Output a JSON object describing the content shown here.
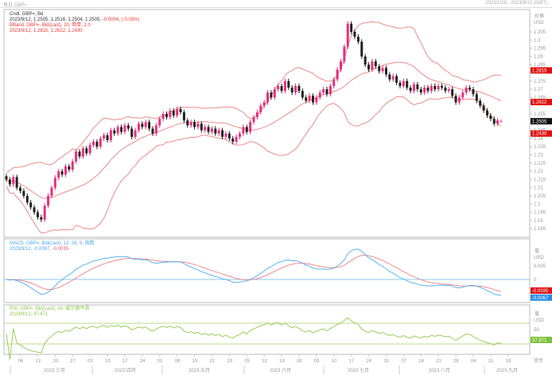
{
  "header": {
    "title": "每日 GBP=",
    "range": "2023/2/28 - 2023/9/12 (GMT)"
  },
  "legend": {
    "candle_name": "Cndl, GBP=, Bd",
    "candle_values": "2023/9/12, 1.2505, 1.2516, 1.2504, 1.2505,",
    "candle_change": "-0.0004, (-0.03%)",
    "bband_name": "BBand, GBP=, Bid(Last), 20, 简单, 2.0",
    "bband_values": "2023/9/12, 1.2815, 1.2622, 1.2430",
    "macd_name": "MACD, GBP=, Bid(Last), 12, 26, 9, 指数",
    "macd_values_a": "2023/9/12, -0.0067,",
    "macd_values_b": "-0.0035",
    "rsi_name": "RSI, GBP=, Bid(Last), 14, 威尔德平滑",
    "rsi_values": "2023/9/12, 37.871"
  },
  "colors": {
    "up": "#e8307a",
    "down": "#222222",
    "band": "#ee8a8a",
    "macd": "#5ab4f0",
    "signal": "#f08a8a",
    "rsi": "#9acd5a",
    "rsi_level": "#b8dc8e",
    "zero": "#8ccaf0",
    "badge_red": "#e01010",
    "badge_black": "#111111",
    "badge_blue": "#2a8ee8",
    "badge_green": "#7cc23a"
  },
  "chart_data": [
    {
      "type": "candlestick",
      "series_label": "GBP=",
      "ylim": [
        1.183,
        1.312
      ],
      "y_unit_label": "价格",
      "y_currency": "USD",
      "yticks": [
        "1.305",
        "1.3",
        "1.295",
        "1.29",
        "1.285",
        "1.275",
        "1.27",
        "1.265",
        "1.255",
        "1.25",
        "1.245",
        "1.24",
        "1.235",
        "1.23",
        "1.225",
        "1.22",
        "1.215",
        "1.21",
        "1.205",
        "1.2",
        "1.195",
        "1.19",
        "1.185"
      ],
      "last_candle": {
        "date": "2023/9/12",
        "open": 1.2505,
        "high": 1.2516,
        "low": 1.2504,
        "close": 1.2505
      },
      "close": [
        1.215,
        1.212,
        1.2165,
        1.21,
        1.208,
        1.205,
        1.201,
        1.198,
        1.195,
        1.192,
        1.1905,
        1.199,
        1.205,
        1.21,
        1.216,
        1.22,
        1.218,
        1.223,
        1.221,
        1.226,
        1.232,
        1.229,
        1.234,
        1.231,
        1.236,
        1.238,
        1.235,
        1.24,
        1.242,
        1.239,
        1.245,
        1.243,
        1.247,
        1.244,
        1.248,
        1.246,
        1.241,
        1.245,
        1.249,
        1.247,
        1.25,
        1.246,
        1.243,
        1.248,
        1.252,
        1.255,
        1.253,
        1.257,
        1.254,
        1.258,
        1.256,
        1.251,
        1.248,
        1.25,
        1.247,
        1.249,
        1.245,
        1.247,
        1.244,
        1.246,
        1.243,
        1.245,
        1.241,
        1.243,
        1.24,
        1.238,
        1.241,
        1.243,
        1.247,
        1.244,
        1.25,
        1.253,
        1.256,
        1.26,
        1.262,
        1.268,
        1.265,
        1.27,
        1.272,
        1.269,
        1.275,
        1.271,
        1.268,
        1.272,
        1.269,
        1.265,
        1.263,
        1.266,
        1.262,
        1.265,
        1.268,
        1.27,
        1.267,
        1.272,
        1.276,
        1.282,
        1.287,
        1.296,
        1.31,
        1.305,
        1.302,
        1.299,
        1.29,
        1.285,
        1.282,
        1.287,
        1.284,
        1.281,
        1.283,
        1.279,
        1.276,
        1.278,
        1.274,
        1.272,
        1.275,
        1.271,
        1.269,
        1.273,
        1.27,
        1.268,
        1.271,
        1.269,
        1.272,
        1.27,
        1.272,
        1.271,
        1.269,
        1.27,
        1.266,
        1.262,
        1.265,
        1.268,
        1.271,
        1.27,
        1.267,
        1.263,
        1.26,
        1.257,
        1.254,
        1.252,
        1.249,
        1.251,
        1.2505
      ],
      "bollinger": {
        "period": 20,
        "stddev": 2.0,
        "last": {
          "upper": 1.2815,
          "middle": 1.2622,
          "lower": 1.243
        }
      },
      "badges": [
        {
          "label": "1.2815",
          "value": 1.2815,
          "color": "red"
        },
        {
          "label": "1.2622",
          "value": 1.2622,
          "color": "red"
        },
        {
          "label": "1.2505",
          "value": 1.2505,
          "color": "black"
        },
        {
          "label": "1.2430",
          "value": 1.243,
          "color": "red"
        }
      ]
    },
    {
      "type": "line",
      "name": "MACD",
      "params": [
        12,
        26,
        9
      ],
      "ylim": [
        -0.0085,
        0.0135
      ],
      "yticks": [
        "0.005",
        "0"
      ],
      "y_unit_label": "值",
      "y_currency": "USD",
      "last": {
        "macd": -0.0067,
        "signal": -0.0035
      },
      "badges": [
        {
          "label": "-0.0035",
          "color": "red"
        },
        {
          "label": "-0.0067",
          "color": "blue"
        }
      ]
    },
    {
      "type": "line",
      "name": "RSI",
      "period": 14,
      "ylim": [
        10,
        90
      ],
      "levels": [
        70,
        30
      ],
      "yticks": [
        "50",
        "30"
      ],
      "y_unit_label": "值",
      "y_currency": "USD",
      "last": 37.871,
      "badges": [
        {
          "label": "37.871",
          "color": "green"
        }
      ]
    }
  ],
  "xaxis": {
    "day_ticks": [
      "06",
      "13",
      "20",
      "27",
      "03",
      "10",
      "17",
      "24",
      "01",
      "08",
      "15",
      "22",
      "29",
      "05",
      "12",
      "19",
      "26",
      "03",
      "10",
      "17",
      "24",
      "31",
      "07",
      "14",
      "21",
      "28",
      "04",
      "11",
      "18"
    ],
    "months": [
      "2023 三月",
      "2023 四月",
      "2023 五月",
      "2023 六月",
      "2023 七月",
      "2023 八月",
      "2023 九月"
    ],
    "panel_footer": "货币"
  }
}
